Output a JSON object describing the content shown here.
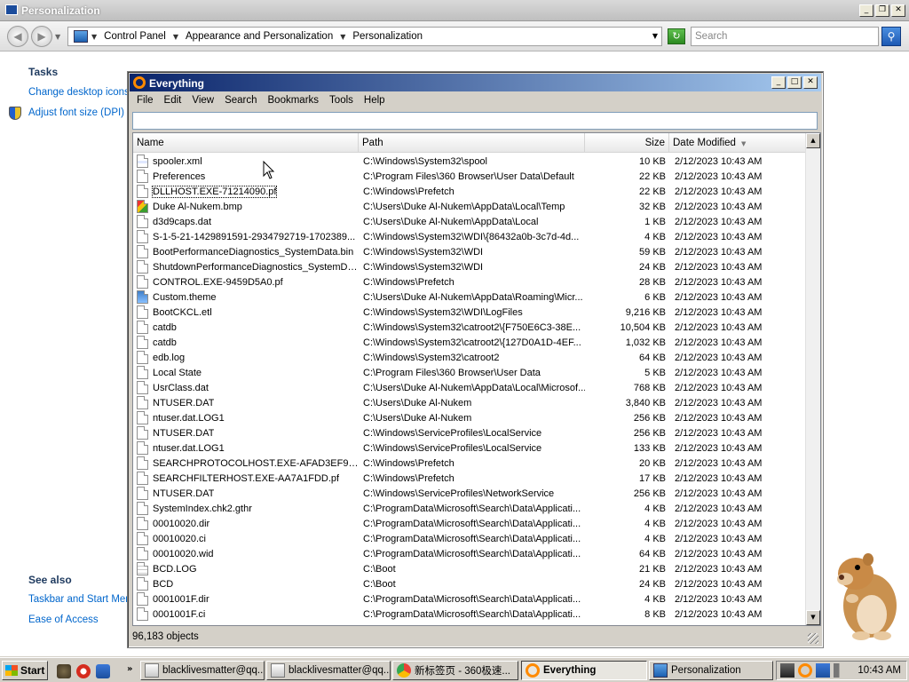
{
  "personalization_window": {
    "title": "Personalization",
    "caption_buttons": [
      "_",
      "❐",
      "✕"
    ],
    "breadcrumbs": [
      "Control Panel",
      "Appearance and Personalization",
      "Personalization"
    ],
    "search_placeholder": "Search",
    "sidebar": {
      "tasks_heading": "Tasks",
      "task_links": [
        "Change desktop icons",
        "Adjust font size (DPI)"
      ],
      "see_also_heading": "See also",
      "see_also_links": [
        "Taskbar and Start Menu",
        "Ease of Access"
      ]
    }
  },
  "everything_window": {
    "title": "Everything",
    "caption_buttons": [
      "_",
      "□",
      "✕"
    ],
    "menu": [
      "File",
      "Edit",
      "View",
      "Search",
      "Bookmarks",
      "Tools",
      "Help"
    ],
    "search_value": "",
    "columns": {
      "name": "Name",
      "path": "Path",
      "size": "Size",
      "date": "Date Modified"
    },
    "rows": [
      {
        "name": "spooler.xml",
        "path": "C:\\Windows\\System32\\spool",
        "size": "10 KB",
        "date": "2/12/2023 10:43 AM",
        "icon": "xml"
      },
      {
        "name": "Preferences",
        "path": "C:\\Program Files\\360 Browser\\User Data\\Default",
        "size": "22 KB",
        "date": "2/12/2023 10:43 AM",
        "icon": "file"
      },
      {
        "name": "DLLHOST.EXE-71214090.pf",
        "path": "C:\\Windows\\Prefetch",
        "size": "22 KB",
        "date": "2/12/2023 10:43 AM",
        "icon": "file"
      },
      {
        "name": "Duke Al-Nukem.bmp",
        "path": "C:\\Users\\Duke Al-Nukem\\AppData\\Local\\Temp",
        "size": "32 KB",
        "date": "2/12/2023 10:43 AM",
        "icon": "bmp"
      },
      {
        "name": "d3d9caps.dat",
        "path": "C:\\Users\\Duke Al-Nukem\\AppData\\Local",
        "size": "1 KB",
        "date": "2/12/2023 10:43 AM",
        "icon": "file"
      },
      {
        "name": "S-1-5-21-1429891591-2934792719-1702389...",
        "path": "C:\\Windows\\System32\\WDI\\{86432a0b-3c7d-4d...",
        "size": "4 KB",
        "date": "2/12/2023 10:43 AM",
        "icon": "file"
      },
      {
        "name": "BootPerformanceDiagnostics_SystemData.bin",
        "path": "C:\\Windows\\System32\\WDI",
        "size": "59 KB",
        "date": "2/12/2023 10:43 AM",
        "icon": "file"
      },
      {
        "name": "ShutdownPerformanceDiagnostics_SystemDa...",
        "path": "C:\\Windows\\System32\\WDI",
        "size": "24 KB",
        "date": "2/12/2023 10:43 AM",
        "icon": "file"
      },
      {
        "name": "CONTROL.EXE-9459D5A0.pf",
        "path": "C:\\Windows\\Prefetch",
        "size": "28 KB",
        "date": "2/12/2023 10:43 AM",
        "icon": "file"
      },
      {
        "name": "Custom.theme",
        "path": "C:\\Users\\Duke Al-Nukem\\AppData\\Roaming\\Micr...",
        "size": "6 KB",
        "date": "2/12/2023 10:43 AM",
        "icon": "theme"
      },
      {
        "name": "BootCKCL.etl",
        "path": "C:\\Windows\\System32\\WDI\\LogFiles",
        "size": "9,216 KB",
        "date": "2/12/2023 10:43 AM",
        "icon": "file"
      },
      {
        "name": "catdb",
        "path": "C:\\Windows\\System32\\catroot2\\{F750E6C3-38E...",
        "size": "10,504 KB",
        "date": "2/12/2023 10:43 AM",
        "icon": "file"
      },
      {
        "name": "catdb",
        "path": "C:\\Windows\\System32\\catroot2\\{127D0A1D-4EF...",
        "size": "1,032 KB",
        "date": "2/12/2023 10:43 AM",
        "icon": "file"
      },
      {
        "name": "edb.log",
        "path": "C:\\Windows\\System32\\catroot2",
        "size": "64 KB",
        "date": "2/12/2023 10:43 AM",
        "icon": "file"
      },
      {
        "name": "Local State",
        "path": "C:\\Program Files\\360 Browser\\User Data",
        "size": "5 KB",
        "date": "2/12/2023 10:43 AM",
        "icon": "file"
      },
      {
        "name": "UsrClass.dat",
        "path": "C:\\Users\\Duke Al-Nukem\\AppData\\Local\\Microsof...",
        "size": "768 KB",
        "date": "2/12/2023 10:43 AM",
        "icon": "file"
      },
      {
        "name": "NTUSER.DAT",
        "path": "C:\\Users\\Duke Al-Nukem",
        "size": "3,840 KB",
        "date": "2/12/2023 10:43 AM",
        "icon": "file"
      },
      {
        "name": "ntuser.dat.LOG1",
        "path": "C:\\Users\\Duke Al-Nukem",
        "size": "256 KB",
        "date": "2/12/2023 10:43 AM",
        "icon": "file"
      },
      {
        "name": "NTUSER.DAT",
        "path": "C:\\Windows\\ServiceProfiles\\LocalService",
        "size": "256 KB",
        "date": "2/12/2023 10:43 AM",
        "icon": "file"
      },
      {
        "name": "ntuser.dat.LOG1",
        "path": "C:\\Windows\\ServiceProfiles\\LocalService",
        "size": "133 KB",
        "date": "2/12/2023 10:43 AM",
        "icon": "file"
      },
      {
        "name": "SEARCHPROTOCOLHOST.EXE-AFAD3EF9.pf",
        "path": "C:\\Windows\\Prefetch",
        "size": "20 KB",
        "date": "2/12/2023 10:43 AM",
        "icon": "file"
      },
      {
        "name": "SEARCHFILTERHOST.EXE-AA7A1FDD.pf",
        "path": "C:\\Windows\\Prefetch",
        "size": "17 KB",
        "date": "2/12/2023 10:43 AM",
        "icon": "file"
      },
      {
        "name": "NTUSER.DAT",
        "path": "C:\\Windows\\ServiceProfiles\\NetworkService",
        "size": "256 KB",
        "date": "2/12/2023 10:43 AM",
        "icon": "file"
      },
      {
        "name": "SystemIndex.chk2.gthr",
        "path": "C:\\ProgramData\\Microsoft\\Search\\Data\\Applicati...",
        "size": "4 KB",
        "date": "2/12/2023 10:43 AM",
        "icon": "file"
      },
      {
        "name": "00010020.dir",
        "path": "C:\\ProgramData\\Microsoft\\Search\\Data\\Applicati...",
        "size": "4 KB",
        "date": "2/12/2023 10:43 AM",
        "icon": "file"
      },
      {
        "name": "00010020.ci",
        "path": "C:\\ProgramData\\Microsoft\\Search\\Data\\Applicati...",
        "size": "4 KB",
        "date": "2/12/2023 10:43 AM",
        "icon": "file"
      },
      {
        "name": "00010020.wid",
        "path": "C:\\ProgramData\\Microsoft\\Search\\Data\\Applicati...",
        "size": "64 KB",
        "date": "2/12/2023 10:43 AM",
        "icon": "file"
      },
      {
        "name": "BCD.LOG",
        "path": "C:\\Boot",
        "size": "21 KB",
        "date": "2/12/2023 10:43 AM",
        "icon": "log"
      },
      {
        "name": "BCD",
        "path": "C:\\Boot",
        "size": "24 KB",
        "date": "2/12/2023 10:43 AM",
        "icon": "file"
      },
      {
        "name": "0001001F.dir",
        "path": "C:\\ProgramData\\Microsoft\\Search\\Data\\Applicati...",
        "size": "4 KB",
        "date": "2/12/2023 10:43 AM",
        "icon": "file"
      },
      {
        "name": "0001001F.ci",
        "path": "C:\\ProgramData\\Microsoft\\Search\\Data\\Applicati...",
        "size": "8 KB",
        "date": "2/12/2023 10:43 AM",
        "icon": "file"
      }
    ],
    "status": "96,183 objects"
  },
  "taskbar": {
    "start_label": "Start",
    "quicklaunch_chevron": "»",
    "buttons": [
      {
        "label": "blacklivesmatter@qq....",
        "icon": "qq-icon",
        "active": false
      },
      {
        "label": "blacklivesmatter@qq....",
        "icon": "qq-icon",
        "active": false
      },
      {
        "label": "新标签页 - 360极速...",
        "icon": "browser-icon",
        "active": false
      },
      {
        "label": "Everything",
        "icon": "everything-icon",
        "active": true
      },
      {
        "label": "Personalization",
        "icon": "personalization-icon",
        "active": false
      }
    ],
    "clock": "10:43 AM"
  }
}
